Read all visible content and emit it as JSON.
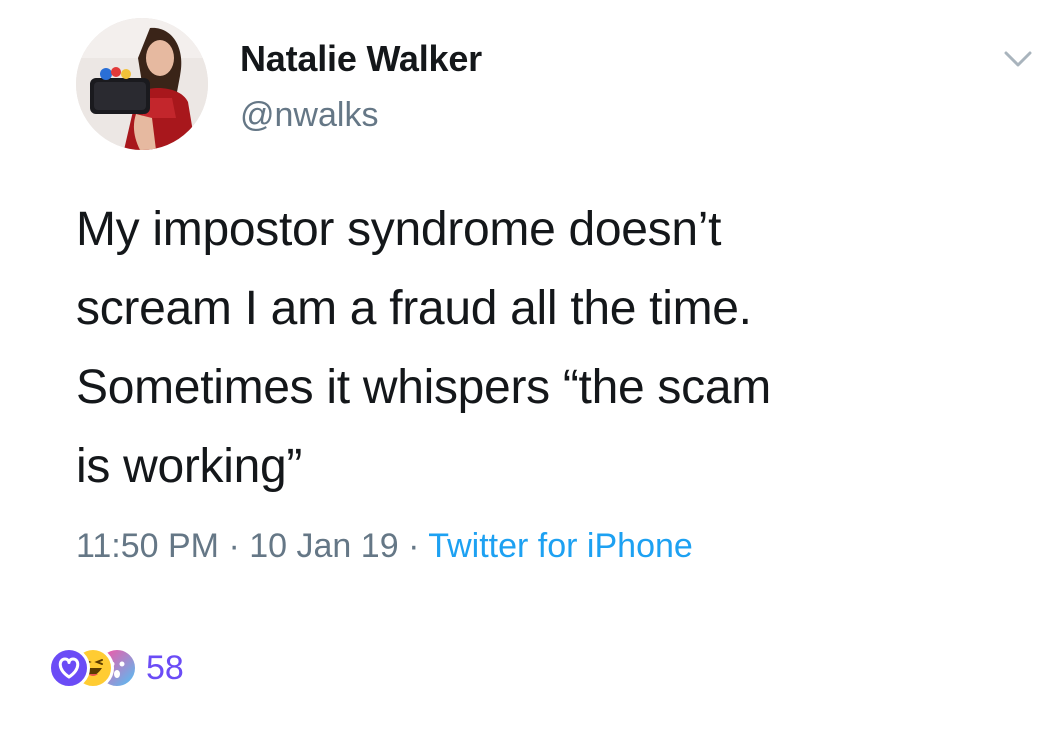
{
  "author": {
    "display_name": "Natalie Walker",
    "handle": "@nwalks"
  },
  "tweet": {
    "lines": [
      "My impostor syndrome doesn’t",
      "scream I am a fraud all the time.",
      "Sometimes it whispers “the scam",
      "is working”"
    ],
    "time": "11:50 PM",
    "date": "10 Jan 19",
    "separator": "·",
    "source": "Twitter for iPhone"
  },
  "reactions": {
    "icons": [
      "heart-icon",
      "laugh-emoji-icon",
      "wow-emoji-icon"
    ],
    "count": "58"
  },
  "colors": {
    "text": "#14171a",
    "secondary": "#657786",
    "link": "#1da1f2",
    "reaction_accent": "#6b4cf6"
  }
}
